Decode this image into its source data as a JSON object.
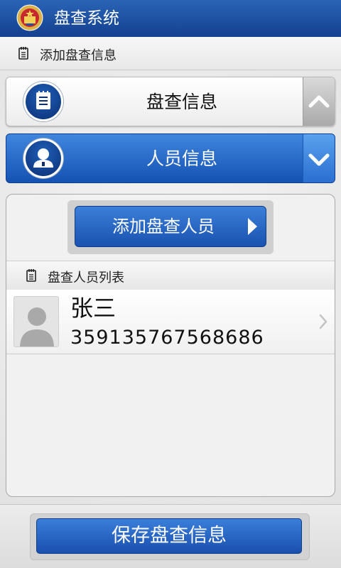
{
  "app": {
    "title": "盘查系统",
    "subheader": "添加盘查信息"
  },
  "sections": {
    "inspection": {
      "label": "盘查信息",
      "state": "collapsed",
      "toggle_icon": "chevron-up-icon"
    },
    "person": {
      "label": "人员信息",
      "state": "expanded",
      "toggle_icon": "chevron-down-icon"
    }
  },
  "person_panel": {
    "add_button": "添加盘查人员",
    "list_title": "盘查人员列表",
    "persons": [
      {
        "name": "张三",
        "id_number": "359135767568686"
      }
    ]
  },
  "footer": {
    "save_button": "保存盘查信息"
  },
  "colors": {
    "title_bar": "#1f56a8",
    "accent_blue": "#2a6ed0",
    "panel_bg": "#f1f1f1"
  }
}
